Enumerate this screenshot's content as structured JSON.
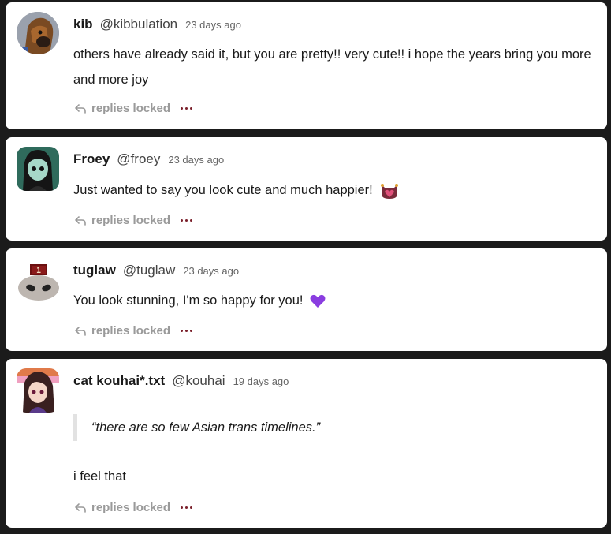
{
  "comments": [
    {
      "name": "kib",
      "handle": "@kibbulation",
      "time": "23 days ago",
      "text": "others have already said it, but you are pretty!! very cute!! i hope the years bring you more and more joy",
      "action": "replies locked"
    },
    {
      "name": "Froey",
      "handle": "@froey",
      "time": "23 days ago",
      "text": "Just wanted to say you look cute and much happier!",
      "emoji": "cat-heart-emoji",
      "action": "replies locked"
    },
    {
      "name": "tuglaw",
      "handle": "@tuglaw",
      "time": "23 days ago",
      "text": "You look stunning, I'm so happy for you!",
      "emoji": "purple-heart-emoji",
      "avatar_badge": "1",
      "action": "replies locked"
    },
    {
      "name": "cat kouhai*.txt",
      "handle": "@kouhai",
      "time": "19 days ago",
      "quote": "“there are so few Asian trans timelines.”",
      "text": "i feel that",
      "action": "replies locked"
    }
  ],
  "colors": {
    "background": "#1b1b1b",
    "card": "#ffffff",
    "muted": "#9a9a9a",
    "dots": "#7a1f2b",
    "purple_heart": "#8a3de0"
  }
}
